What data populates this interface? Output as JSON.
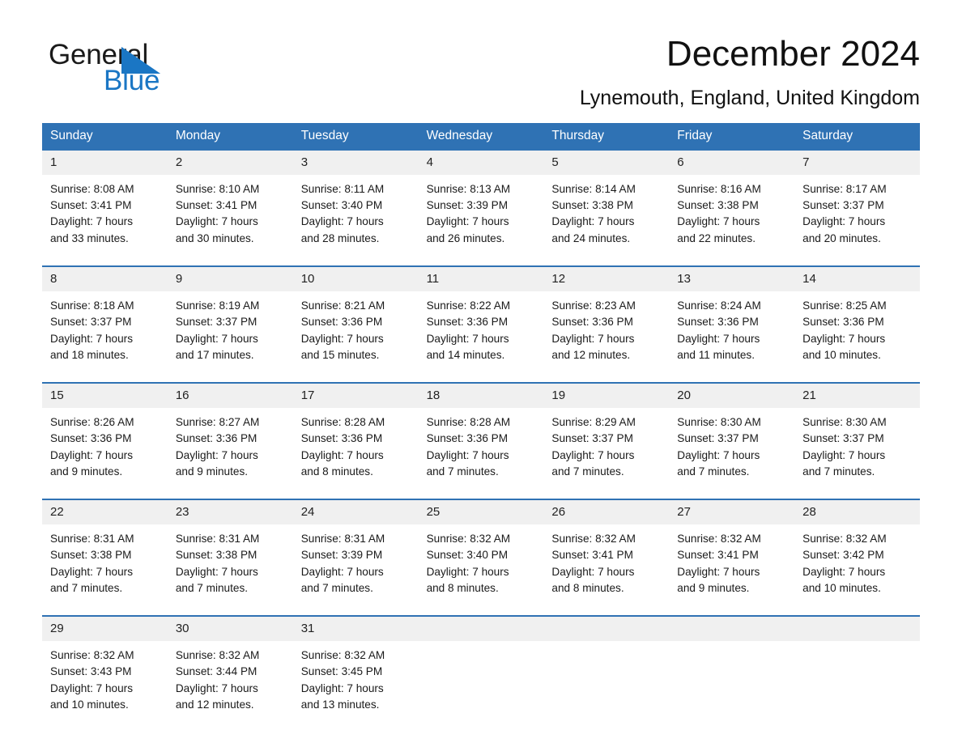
{
  "brand": {
    "name_part1": "General",
    "name_part2": "Blue",
    "logo_icon": "blue-triangle-icon",
    "accent_color": "#1a76c4"
  },
  "header": {
    "title": "December 2024",
    "location": "Lynemouth, England, United Kingdom"
  },
  "colors": {
    "header_blue": "#2f72b4",
    "daynum_band": "#f0f0f0",
    "text": "#1a1a1a"
  },
  "calendar": {
    "weekdays": [
      "Sunday",
      "Monday",
      "Tuesday",
      "Wednesday",
      "Thursday",
      "Friday",
      "Saturday"
    ],
    "weeks": [
      [
        {
          "day": "1",
          "sunrise": "Sunrise: 8:08 AM",
          "sunset": "Sunset: 3:41 PM",
          "daylight_line1": "Daylight: 7 hours",
          "daylight_line2": "and 33 minutes."
        },
        {
          "day": "2",
          "sunrise": "Sunrise: 8:10 AM",
          "sunset": "Sunset: 3:41 PM",
          "daylight_line1": "Daylight: 7 hours",
          "daylight_line2": "and 30 minutes."
        },
        {
          "day": "3",
          "sunrise": "Sunrise: 8:11 AM",
          "sunset": "Sunset: 3:40 PM",
          "daylight_line1": "Daylight: 7 hours",
          "daylight_line2": "and 28 minutes."
        },
        {
          "day": "4",
          "sunrise": "Sunrise: 8:13 AM",
          "sunset": "Sunset: 3:39 PM",
          "daylight_line1": "Daylight: 7 hours",
          "daylight_line2": "and 26 minutes."
        },
        {
          "day": "5",
          "sunrise": "Sunrise: 8:14 AM",
          "sunset": "Sunset: 3:38 PM",
          "daylight_line1": "Daylight: 7 hours",
          "daylight_line2": "and 24 minutes."
        },
        {
          "day": "6",
          "sunrise": "Sunrise: 8:16 AM",
          "sunset": "Sunset: 3:38 PM",
          "daylight_line1": "Daylight: 7 hours",
          "daylight_line2": "and 22 minutes."
        },
        {
          "day": "7",
          "sunrise": "Sunrise: 8:17 AM",
          "sunset": "Sunset: 3:37 PM",
          "daylight_line1": "Daylight: 7 hours",
          "daylight_line2": "and 20 minutes."
        }
      ],
      [
        {
          "day": "8",
          "sunrise": "Sunrise: 8:18 AM",
          "sunset": "Sunset: 3:37 PM",
          "daylight_line1": "Daylight: 7 hours",
          "daylight_line2": "and 18 minutes."
        },
        {
          "day": "9",
          "sunrise": "Sunrise: 8:19 AM",
          "sunset": "Sunset: 3:37 PM",
          "daylight_line1": "Daylight: 7 hours",
          "daylight_line2": "and 17 minutes."
        },
        {
          "day": "10",
          "sunrise": "Sunrise: 8:21 AM",
          "sunset": "Sunset: 3:36 PM",
          "daylight_line1": "Daylight: 7 hours",
          "daylight_line2": "and 15 minutes."
        },
        {
          "day": "11",
          "sunrise": "Sunrise: 8:22 AM",
          "sunset": "Sunset: 3:36 PM",
          "daylight_line1": "Daylight: 7 hours",
          "daylight_line2": "and 14 minutes."
        },
        {
          "day": "12",
          "sunrise": "Sunrise: 8:23 AM",
          "sunset": "Sunset: 3:36 PM",
          "daylight_line1": "Daylight: 7 hours",
          "daylight_line2": "and 12 minutes."
        },
        {
          "day": "13",
          "sunrise": "Sunrise: 8:24 AM",
          "sunset": "Sunset: 3:36 PM",
          "daylight_line1": "Daylight: 7 hours",
          "daylight_line2": "and 11 minutes."
        },
        {
          "day": "14",
          "sunrise": "Sunrise: 8:25 AM",
          "sunset": "Sunset: 3:36 PM",
          "daylight_line1": "Daylight: 7 hours",
          "daylight_line2": "and 10 minutes."
        }
      ],
      [
        {
          "day": "15",
          "sunrise": "Sunrise: 8:26 AM",
          "sunset": "Sunset: 3:36 PM",
          "daylight_line1": "Daylight: 7 hours",
          "daylight_line2": "and 9 minutes."
        },
        {
          "day": "16",
          "sunrise": "Sunrise: 8:27 AM",
          "sunset": "Sunset: 3:36 PM",
          "daylight_line1": "Daylight: 7 hours",
          "daylight_line2": "and 9 minutes."
        },
        {
          "day": "17",
          "sunrise": "Sunrise: 8:28 AM",
          "sunset": "Sunset: 3:36 PM",
          "daylight_line1": "Daylight: 7 hours",
          "daylight_line2": "and 8 minutes."
        },
        {
          "day": "18",
          "sunrise": "Sunrise: 8:28 AM",
          "sunset": "Sunset: 3:36 PM",
          "daylight_line1": "Daylight: 7 hours",
          "daylight_line2": "and 7 minutes."
        },
        {
          "day": "19",
          "sunrise": "Sunrise: 8:29 AM",
          "sunset": "Sunset: 3:37 PM",
          "daylight_line1": "Daylight: 7 hours",
          "daylight_line2": "and 7 minutes."
        },
        {
          "day": "20",
          "sunrise": "Sunrise: 8:30 AM",
          "sunset": "Sunset: 3:37 PM",
          "daylight_line1": "Daylight: 7 hours",
          "daylight_line2": "and 7 minutes."
        },
        {
          "day": "21",
          "sunrise": "Sunrise: 8:30 AM",
          "sunset": "Sunset: 3:37 PM",
          "daylight_line1": "Daylight: 7 hours",
          "daylight_line2": "and 7 minutes."
        }
      ],
      [
        {
          "day": "22",
          "sunrise": "Sunrise: 8:31 AM",
          "sunset": "Sunset: 3:38 PM",
          "daylight_line1": "Daylight: 7 hours",
          "daylight_line2": "and 7 minutes."
        },
        {
          "day": "23",
          "sunrise": "Sunrise: 8:31 AM",
          "sunset": "Sunset: 3:38 PM",
          "daylight_line1": "Daylight: 7 hours",
          "daylight_line2": "and 7 minutes."
        },
        {
          "day": "24",
          "sunrise": "Sunrise: 8:31 AM",
          "sunset": "Sunset: 3:39 PM",
          "daylight_line1": "Daylight: 7 hours",
          "daylight_line2": "and 7 minutes."
        },
        {
          "day": "25",
          "sunrise": "Sunrise: 8:32 AM",
          "sunset": "Sunset: 3:40 PM",
          "daylight_line1": "Daylight: 7 hours",
          "daylight_line2": "and 8 minutes."
        },
        {
          "day": "26",
          "sunrise": "Sunrise: 8:32 AM",
          "sunset": "Sunset: 3:41 PM",
          "daylight_line1": "Daylight: 7 hours",
          "daylight_line2": "and 8 minutes."
        },
        {
          "day": "27",
          "sunrise": "Sunrise: 8:32 AM",
          "sunset": "Sunset: 3:41 PM",
          "daylight_line1": "Daylight: 7 hours",
          "daylight_line2": "and 9 minutes."
        },
        {
          "day": "28",
          "sunrise": "Sunrise: 8:32 AM",
          "sunset": "Sunset: 3:42 PM",
          "daylight_line1": "Daylight: 7 hours",
          "daylight_line2": "and 10 minutes."
        }
      ],
      [
        {
          "day": "29",
          "sunrise": "Sunrise: 8:32 AM",
          "sunset": "Sunset: 3:43 PM",
          "daylight_line1": "Daylight: 7 hours",
          "daylight_line2": "and 10 minutes."
        },
        {
          "day": "30",
          "sunrise": "Sunrise: 8:32 AM",
          "sunset": "Sunset: 3:44 PM",
          "daylight_line1": "Daylight: 7 hours",
          "daylight_line2": "and 12 minutes."
        },
        {
          "day": "31",
          "sunrise": "Sunrise: 8:32 AM",
          "sunset": "Sunset: 3:45 PM",
          "daylight_line1": "Daylight: 7 hours",
          "daylight_line2": "and 13 minutes."
        },
        {
          "day": "",
          "sunrise": "",
          "sunset": "",
          "daylight_line1": "",
          "daylight_line2": ""
        },
        {
          "day": "",
          "sunrise": "",
          "sunset": "",
          "daylight_line1": "",
          "daylight_line2": ""
        },
        {
          "day": "",
          "sunrise": "",
          "sunset": "",
          "daylight_line1": "",
          "daylight_line2": ""
        },
        {
          "day": "",
          "sunrise": "",
          "sunset": "",
          "daylight_line1": "",
          "daylight_line2": ""
        }
      ]
    ]
  }
}
